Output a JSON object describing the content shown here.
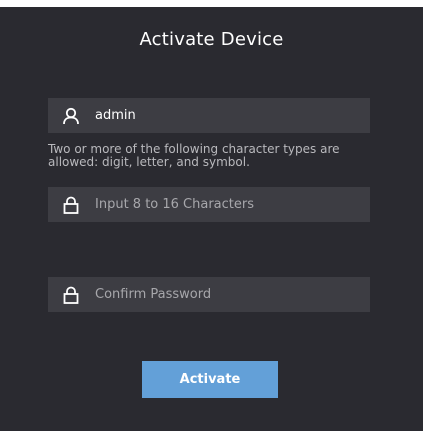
{
  "dialog": {
    "title": "Activate Device",
    "username": {
      "value": "admin",
      "icon": "user-icon"
    },
    "hint": "Two or more of the following character types are allowed: digit, letter, and symbol.",
    "password": {
      "value": "",
      "placeholder": "Input 8 to 16 Characters",
      "icon": "lock-icon"
    },
    "confirm_password": {
      "value": "",
      "placeholder": "Confirm Password",
      "icon": "lock-icon"
    },
    "activate_label": "Activate"
  },
  "colors": {
    "background": "#2a2a30",
    "field": "#3d3d43",
    "button": "#63a0d8"
  }
}
